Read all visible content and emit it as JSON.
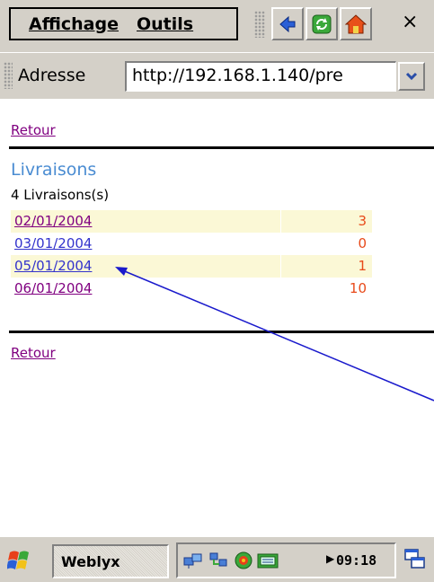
{
  "menubar": {
    "items": [
      {
        "label": "Affichage"
      },
      {
        "label": "Outils"
      }
    ]
  },
  "toolbar": {
    "close_label": "×"
  },
  "address": {
    "label": "Adresse",
    "value": "http://192.168.1.140/pre"
  },
  "page": {
    "back_link_top": "Retour",
    "title": "Livraisons",
    "count_text": "4 Livraisons(s)",
    "rows": [
      {
        "date": "02/01/2004",
        "value": "3"
      },
      {
        "date": "03/01/2004",
        "value": "0"
      },
      {
        "date": "05/01/2004",
        "value": "1"
      },
      {
        "date": "06/01/2004",
        "value": "10"
      }
    ],
    "back_link_bottom": "Retour"
  },
  "taskbar": {
    "app_button": "Weblyx",
    "clock": "09:18"
  },
  "colors": {
    "title": "#4a8cd2",
    "value": "#e84a1a",
    "row_highlight": "#fbf8d6",
    "visited_link": "#800080",
    "link": "#3333cc",
    "annotation_arrow": "#1a1acc"
  }
}
